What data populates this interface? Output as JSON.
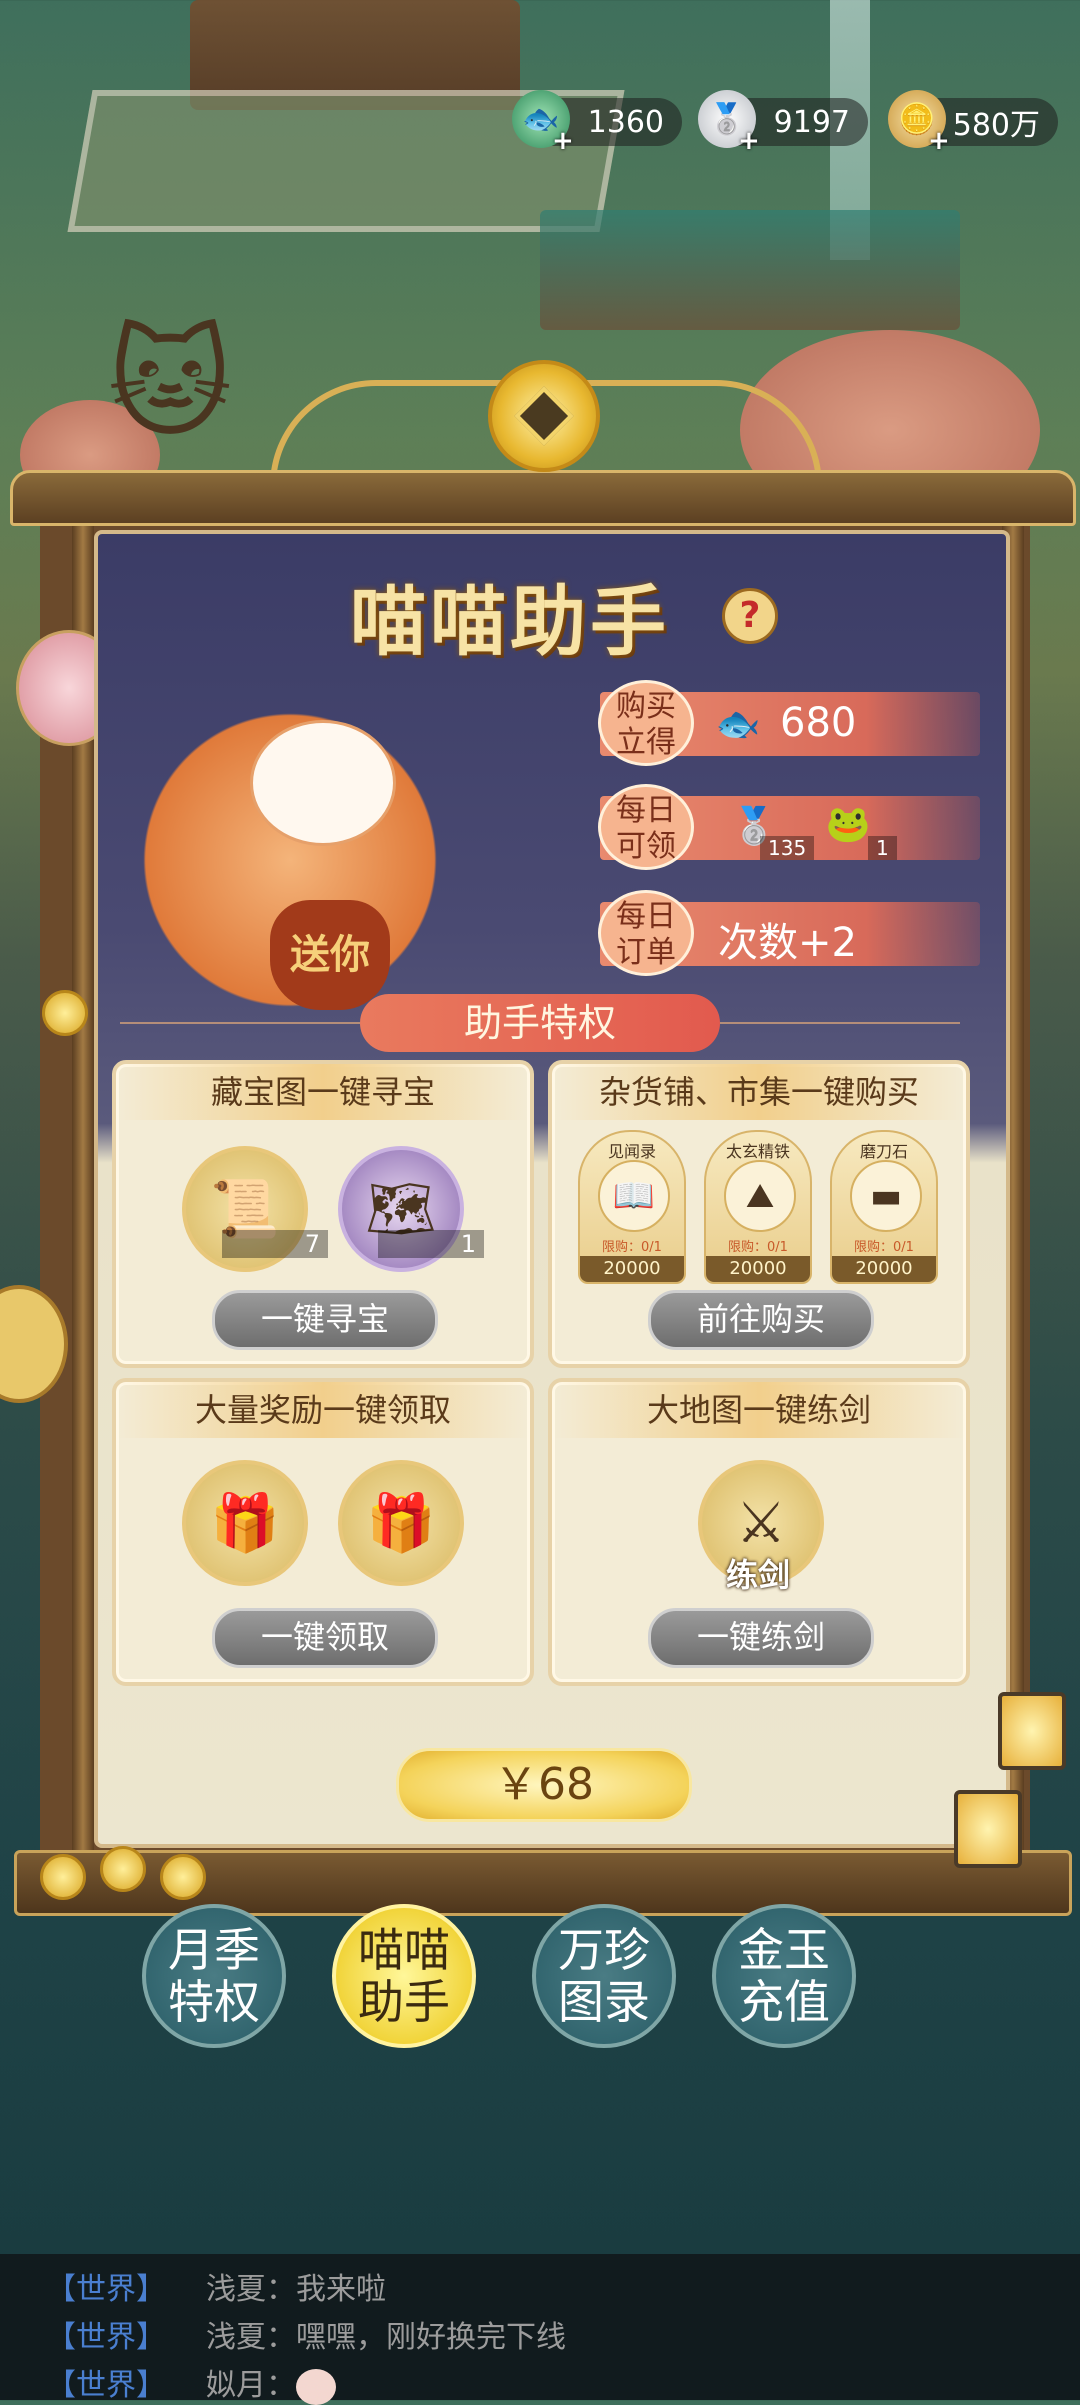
{
  "currencies": [
    {
      "icon": "jade-fish-icon",
      "value": "1360"
    },
    {
      "icon": "silver-ingot-icon",
      "value": "9197"
    },
    {
      "icon": "copper-coins-icon",
      "value": "580万"
    }
  ],
  "panel": {
    "title": "喵喵助手",
    "benefits": [
      {
        "tag": "购买立得",
        "tag_l1": "购买",
        "tag_l2": "立得",
        "value": "680"
      },
      {
        "tag": "每日可领",
        "tag_l1": "每日",
        "tag_l2": "可领",
        "items": [
          {
            "icon": "silver-ingot-icon",
            "qty": "135"
          },
          {
            "icon": "gold-toad-icon",
            "qty": "1"
          }
        ]
      },
      {
        "tag": "每日订单",
        "tag_l1": "每日",
        "tag_l2": "订单",
        "value": "次数+2"
      }
    ],
    "bag_text": "送你",
    "privilege_header": "助手特权",
    "cards": [
      {
        "title": "藏宝图一键寻宝",
        "items": [
          {
            "icon": "treasure-map-icon",
            "qty": "7"
          },
          {
            "icon": "torn-map-icon",
            "qty": "1"
          }
        ],
        "button": "一键寻宝"
      },
      {
        "title": "杂货铺、市集一键购买",
        "shop": [
          {
            "name": "见闻录",
            "icon": "book-icon",
            "limit": "限购：0/1",
            "price": "20000"
          },
          {
            "name": "太玄精铁",
            "icon": "iron-ore-icon",
            "limit": "限购：0/1",
            "price": "20000"
          },
          {
            "name": "磨刀石",
            "icon": "whetstone-icon",
            "limit": "限购：0/1",
            "price": "20000"
          }
        ],
        "button": "前往购买"
      },
      {
        "title": "大量奖励一键领取",
        "items": [
          {
            "icon": "reward-chest-icon"
          },
          {
            "icon": "reward-chest-icon"
          }
        ],
        "button": "一键领取"
      },
      {
        "title": "大地图一键练剑",
        "items": [
          {
            "icon": "swordsman-icon",
            "label": "练剑"
          }
        ],
        "button": "一键练剑"
      }
    ],
    "price": "￥68"
  },
  "tabs": [
    {
      "l1": "月季",
      "l2": "特权",
      "active": false
    },
    {
      "l1": "喵喵",
      "l2": "助手",
      "active": true
    },
    {
      "l1": "万珍",
      "l2": "图录",
      "active": false
    },
    {
      "l1": "金玉",
      "l2": "充值",
      "active": false
    }
  ],
  "chat": [
    {
      "channel": "【世界】",
      "text": "浅夏：我来啦"
    },
    {
      "channel": "【世界】",
      "text": "浅夏：嘿嘿，刚好换完下线"
    },
    {
      "channel": "【世界】",
      "text": "姒月："
    }
  ],
  "colors": {
    "accent_gold": "#f4d35a",
    "panel_dark": "#3b3c66",
    "card_bg": "#f3ecd6",
    "chat_channel": "#4a7fd0"
  }
}
